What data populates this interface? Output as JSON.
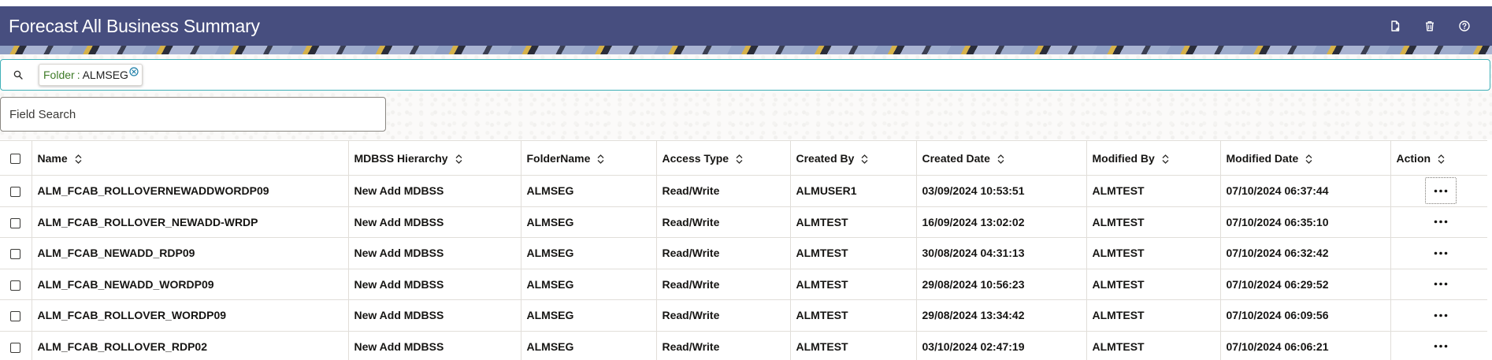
{
  "header": {
    "title": "Forecast All Business Summary",
    "actions": [
      {
        "name": "new-document-icon",
        "label": "Add"
      },
      {
        "name": "delete-icon",
        "label": "Delete"
      },
      {
        "name": "help-icon",
        "label": "Help"
      }
    ],
    "background": "#474e7f"
  },
  "filter": {
    "chip_key": "Folder",
    "chip_separator": ":",
    "chip_value": "ALMSEG",
    "accent": "#3fb0b7"
  },
  "field_search": {
    "placeholder": "Field Search",
    "value": ""
  },
  "table": {
    "columns": [
      "Name",
      "MDBSS Hierarchy",
      "FolderName",
      "Access Type",
      "Created By",
      "Created Date",
      "Modified By",
      "Modified Date",
      "Action"
    ],
    "rows": [
      [
        "ALM_FCAB_ROLLOVERNEWADDWORDP09",
        "New Add MDBSS",
        "ALMSEG",
        "Read/Write",
        "ALMUSER1",
        "03/09/2024 10:53:51",
        "ALMTEST",
        "07/10/2024 06:37:44"
      ],
      [
        "ALM_FCAB_ROLLOVER_NEWADD-WRDP",
        "New Add MDBSS",
        "ALMSEG",
        "Read/Write",
        "ALMTEST",
        "16/09/2024 13:02:02",
        "ALMTEST",
        "07/10/2024 06:35:10"
      ],
      [
        "ALM_FCAB_NEWADD_RDP09",
        "New Add MDBSS",
        "ALMSEG",
        "Read/Write",
        "ALMTEST",
        "30/08/2024 04:31:13",
        "ALMTEST",
        "07/10/2024 06:32:42"
      ],
      [
        "ALM_FCAB_NEWADD_WORDP09",
        "New Add MDBSS",
        "ALMSEG",
        "Read/Write",
        "ALMTEST",
        "29/08/2024 10:56:23",
        "ALMTEST",
        "07/10/2024 06:29:52"
      ],
      [
        "ALM_FCAB_ROLLOVER_WORDP09",
        "New Add MDBSS",
        "ALMSEG",
        "Read/Write",
        "ALMTEST",
        "29/08/2024 13:34:42",
        "ALMTEST",
        "07/10/2024 06:09:56"
      ],
      [
        "ALM_FCAB_ROLLOVER_RDP02",
        "New Add MDBSS",
        "ALMSEG",
        "Read/Write",
        "ALMTEST",
        "03/10/2024 02:47:19",
        "ALMTEST",
        "07/10/2024 06:06:21"
      ]
    ],
    "row_action_icon": "more-horizontal-icon"
  }
}
